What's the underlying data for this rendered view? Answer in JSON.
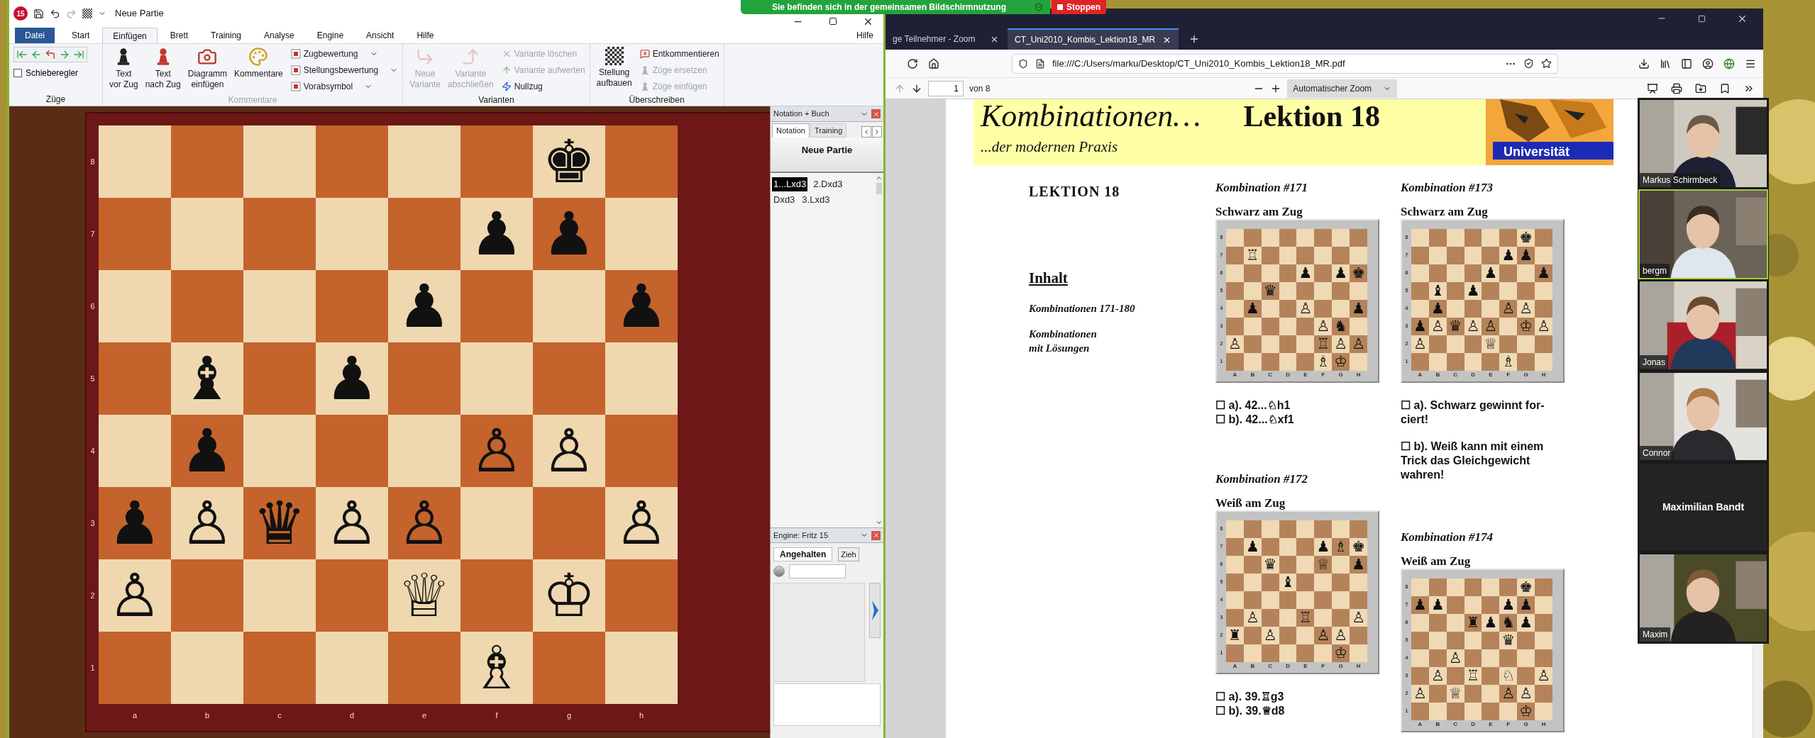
{
  "share_banner": {
    "text": "Sie befinden sich in der gemeinsamen Bildschirmnutzung",
    "stop_button": "Stoppen"
  },
  "chessbase": {
    "app_badge": "15",
    "title": "Neue Partie",
    "menu_tabs": [
      {
        "label": "Datei",
        "kind": "file"
      },
      {
        "label": "Start",
        "kind": "tab",
        "selected": false
      },
      {
        "label": "Einfügen",
        "kind": "tab",
        "selected": true
      },
      {
        "label": "Brett",
        "kind": "tab",
        "selected": false
      },
      {
        "label": "Training",
        "kind": "tab",
        "selected": false
      },
      {
        "label": "Analyse",
        "kind": "tab",
        "selected": false
      },
      {
        "label": "Engine",
        "kind": "tab",
        "selected": false
      },
      {
        "label": "Ansicht",
        "kind": "tab",
        "selected": false
      },
      {
        "label": "Hilfe",
        "kind": "tab",
        "selected": false
      }
    ],
    "help_link": "Hilfe",
    "ribbon": {
      "groups": [
        {
          "kind": "moves",
          "label": "Züge",
          "disabled": false,
          "checkbox": {
            "label": "Schieberegler",
            "checked": false
          }
        },
        {
          "kind": "comments",
          "label": "Kommentare",
          "disabled": true,
          "big_buttons": [
            {
              "lines": [
                "Text",
                "vor Zug"
              ],
              "disabled": false
            },
            {
              "lines": [
                "Text",
                "nach Zug"
              ],
              "disabled": false
            },
            {
              "lines": [
                "Diagramm",
                "einfügen"
              ],
              "disabled": false
            },
            {
              "lines": [
                "Kommentare"
              ],
              "disabled": false
            }
          ],
          "small_buttons": [
            {
              "label": "Zugbewertung",
              "disabled": false
            },
            {
              "label": "Stellungsbewertung",
              "disabled": false
            },
            {
              "label": "Vorabsymbol",
              "disabled": false
            }
          ]
        },
        {
          "kind": "variations",
          "label": "Varianten",
          "disabled": false,
          "big_buttons": [
            {
              "lines": [
                "Neue",
                "Variante"
              ],
              "disabled": true
            },
            {
              "lines": [
                "Variante",
                "abschließen"
              ],
              "disabled": true
            }
          ],
          "small_buttons": [
            {
              "label": "Variante löschen",
              "disabled": true
            },
            {
              "label": "Variante aufwerten",
              "disabled": true
            },
            {
              "label": "Nullzug",
              "disabled": false
            }
          ]
        },
        {
          "kind": "overwrite",
          "label": "Überschreiben",
          "disabled": false,
          "big_buttons": [
            {
              "lines": [
                "Stellung",
                "aufbauen"
              ],
              "disabled": false
            }
          ],
          "small_buttons": [
            {
              "label": "Entkommentieren",
              "disabled": false
            },
            {
              "label": "Züge ersetzen",
              "disabled": true
            },
            {
              "label": "Züge einfügen",
              "disabled": true
            }
          ]
        }
      ]
    },
    "board": {
      "files": [
        "a",
        "b",
        "c",
        "d",
        "e",
        "f",
        "g",
        "h"
      ],
      "ranks": [
        "8",
        "7",
        "6",
        "5",
        "4",
        "3",
        "2",
        "1"
      ],
      "rows": [
        [
          {},
          {},
          {},
          {},
          {},
          {},
          {
            "glyph": "♚"
          },
          {}
        ],
        [
          {},
          {},
          {},
          {},
          {},
          {
            "glyph": "♟"
          },
          {
            "glyph": "♟"
          },
          {}
        ],
        [
          {},
          {},
          {},
          {},
          {
            "glyph": "♟"
          },
          {},
          {},
          {
            "glyph": "♟"
          }
        ],
        [
          {},
          {
            "glyph": "♝"
          },
          {},
          {
            "glyph": "♟"
          },
          {},
          {},
          {},
          {}
        ],
        [
          {},
          {
            "glyph": "♟"
          },
          {},
          {},
          {},
          {
            "glyph": "♙"
          },
          {
            "glyph": "♙"
          },
          {}
        ],
        [
          {
            "glyph": "♟"
          },
          {
            "glyph": "♙"
          },
          {
            "glyph": "♛"
          },
          {
            "glyph": "♙"
          },
          {
            "glyph": "♙"
          },
          {},
          {},
          {
            "glyph": "♙"
          }
        ],
        [
          {
            "glyph": "♙"
          },
          {},
          {},
          {},
          {
            "glyph": "♕"
          },
          {},
          {
            "glyph": "♔"
          },
          {}
        ],
        [
          {},
          {},
          {},
          {},
          {},
          {
            "glyph": "♗"
          },
          {},
          {}
        ]
      ]
    },
    "notation_panel": {
      "title": "Notation + Buch",
      "tabs": [
        {
          "label": "Notation",
          "selected": true
        },
        {
          "label": "Training",
          "selected": false
        }
      ],
      "game_title": "Neue Partie",
      "move_lines": [
        [
          {
            "text": "1...Lxd3",
            "selected": true
          },
          {
            "text": "2.Dxd3",
            "selected": false
          }
        ],
        [
          {
            "text": "Dxd3",
            "selected": false
          },
          {
            "text": "3.Lxd3",
            "selected": false
          }
        ]
      ]
    },
    "engine_panel": {
      "title": "Engine: Fritz 15",
      "status_button": "Angehalten",
      "move_button": "Zieh"
    }
  },
  "browser": {
    "tabs": [
      {
        "title": "ge Teilnehmer - Zoom",
        "selected": false
      },
      {
        "title": "CT_Uni2010_Kombis_Lektion18_MR",
        "selected": true
      }
    ],
    "url": "file:///C:/Users/marku/Desktop/CT_Uni2010_Kombis_Lektion18_MR.pdf",
    "pdf_toolbar": {
      "page": "1",
      "page_count": "von 8",
      "zoom": "Automatischer Zoom"
    }
  },
  "pdf": {
    "header_title": "Kombinationen…",
    "header_lesson": "Lektion 18",
    "header_subtitle": "...der modernen Praxis",
    "logo_text": "Universität",
    "lesson_heading": "LEKTION 18",
    "contents_heading": "Inhalt",
    "contents_items": [
      {
        "lines": [
          "Kombinationen 171-180"
        ]
      },
      {
        "lines": [
          "Kombinationen",
          "mit Lösungen"
        ]
      }
    ],
    "columns": [
      [
        {
          "title": "Kombination #171",
          "to_move": "Schwarz am Zug",
          "files": [
            "A",
            "B",
            "C",
            "D",
            "E",
            "F",
            "G",
            "H"
          ],
          "ranks": [
            "8",
            "7",
            "6",
            "5",
            "4",
            "3",
            "2",
            "1"
          ],
          "rows": [
            [
              {},
              {},
              {},
              {},
              {},
              {},
              {},
              {}
            ],
            [
              {},
              {
                "glyph": "♖"
              },
              {},
              {},
              {},
              {},
              {},
              {}
            ],
            [
              {},
              {},
              {},
              {},
              {
                "glyph": "♟"
              },
              {},
              {
                "glyph": "♟"
              },
              {
                "glyph": "♚"
              }
            ],
            [
              {},
              {},
              {
                "glyph": "♛"
              },
              {},
              {},
              {},
              {},
              {}
            ],
            [
              {},
              {
                "glyph": "♟"
              },
              {},
              {},
              {
                "glyph": "♙"
              },
              {},
              {},
              {
                "glyph": "♟"
              }
            ],
            [
              {},
              {},
              {},
              {},
              {},
              {
                "glyph": "♙"
              },
              {
                "glyph": "♞"
              },
              {}
            ],
            [
              {
                "glyph": "♙"
              },
              {},
              {},
              {},
              {},
              {
                "glyph": "♖"
              },
              {
                "glyph": "♙"
              },
              {
                "glyph": "♙"
              }
            ],
            [
              {},
              {},
              {},
              {},
              {},
              {
                "glyph": "♗"
              },
              {
                "glyph": "♔"
              },
              {}
            ]
          ],
          "options": [
            {
              "lines": [
                "☐ a). 42...♘h1"
              ]
            },
            {
              "lines": [
                "☐ b). 42...♘xf1"
              ]
            }
          ]
        },
        {
          "title": "Kombination #172",
          "to_move": "Weiß am Zug",
          "files": [
            "A",
            "B",
            "C",
            "D",
            "E",
            "F",
            "G",
            "H"
          ],
          "ranks": [
            "8",
            "7",
            "6",
            "5",
            "4",
            "3",
            "2",
            "1"
          ],
          "rows": [
            [
              {},
              {},
              {},
              {},
              {},
              {},
              {},
              {}
            ],
            [
              {},
              {
                "glyph": "♟"
              },
              {},
              {},
              {},
              {
                "glyph": "♟"
              },
              {
                "glyph": "♗"
              },
              {
                "glyph": "♚"
              }
            ],
            [
              {},
              {},
              {
                "glyph": "♛"
              },
              {},
              {},
              {
                "glyph": "♕"
              },
              {},
              {
                "glyph": "♟"
              }
            ],
            [
              {},
              {},
              {},
              {
                "glyph": "♝"
              },
              {},
              {},
              {},
              {}
            ],
            [
              {},
              {},
              {},
              {},
              {},
              {},
              {},
              {}
            ],
            [
              {},
              {
                "glyph": "♙"
              },
              {},
              {},
              {
                "glyph": "♖"
              },
              {},
              {},
              {
                "glyph": "♙"
              }
            ],
            [
              {
                "glyph": "♜"
              },
              {},
              {
                "glyph": "♙"
              },
              {},
              {},
              {
                "glyph": "♙"
              },
              {
                "glyph": "♙"
              },
              {}
            ],
            [
              {},
              {},
              {},
              {},
              {},
              {},
              {
                "glyph": "♔"
              },
              {}
            ]
          ],
          "options": [
            {
              "lines": [
                "☐ a). 39.♖g3"
              ]
            },
            {
              "lines": [
                "☐ b). 39.♕d8"
              ]
            }
          ]
        }
      ],
      [
        {
          "title": "Kombination #173",
          "to_move": "Schwarz am Zug",
          "files": [
            "A",
            "B",
            "C",
            "D",
            "E",
            "F",
            "G",
            "H"
          ],
          "ranks": [
            "8",
            "7",
            "6",
            "5",
            "4",
            "3",
            "2",
            "1"
          ],
          "rows": [
            [
              {},
              {},
              {},
              {},
              {},
              {},
              {
                "glyph": "♚"
              },
              {}
            ],
            [
              {},
              {},
              {},
              {},
              {},
              {
                "glyph": "♟"
              },
              {
                "glyph": "♟"
              },
              {}
            ],
            [
              {},
              {},
              {},
              {},
              {
                "glyph": "♟"
              },
              {},
              {},
              {
                "glyph": "♟"
              }
            ],
            [
              {},
              {
                "glyph": "♝"
              },
              {},
              {
                "glyph": "♟"
              },
              {},
              {},
              {},
              {}
            ],
            [
              {},
              {
                "glyph": "♟"
              },
              {},
              {},
              {},
              {
                "glyph": "♙"
              },
              {
                "glyph": "♙"
              },
              {}
            ],
            [
              {
                "glyph": "♟"
              },
              {
                "glyph": "♙"
              },
              {
                "glyph": "♛"
              },
              {
                "glyph": "♙"
              },
              {
                "glyph": "♙"
              },
              {},
              {
                "glyph": "♔"
              },
              {
                "glyph": "♙"
              }
            ],
            [
              {
                "glyph": "♙"
              },
              {},
              {},
              {},
              {
                "glyph": "♕"
              },
              {},
              {},
              {}
            ],
            [
              {},
              {},
              {},
              {},
              {},
              {
                "glyph": "♗"
              },
              {},
              {}
            ]
          ],
          "options": [
            {
              "lines": [
                "☐ a). Schwarz gewinnt for-",
                "ciert!"
              ]
            },
            {
              "lines": [
                "☐ b). Weiß kann mit einem",
                "Trick das Gleichgewicht",
                "wahren!"
              ]
            }
          ]
        },
        {
          "title": "Kombination #174",
          "to_move": "Weiß am Zug",
          "files": [
            "A",
            "B",
            "C",
            "D",
            "E",
            "F",
            "G",
            "H"
          ],
          "ranks": [
            "8",
            "7",
            "6",
            "5",
            "4",
            "3",
            "2",
            "1"
          ],
          "rows": [
            [
              {},
              {},
              {},
              {},
              {},
              {},
              {
                "glyph": "♚"
              },
              {}
            ],
            [
              {
                "glyph": "♟"
              },
              {
                "glyph": "♟"
              },
              {},
              {},
              {},
              {
                "glyph": "♟"
              },
              {
                "glyph": "♟"
              },
              {}
            ],
            [
              {},
              {},
              {},
              {
                "glyph": "♜"
              },
              {
                "glyph": "♟"
              },
              {
                "glyph": "♞"
              },
              {
                "glyph": "♟"
              },
              {}
            ],
            [
              {},
              {},
              {},
              {},
              {},
              {
                "glyph": "♛"
              },
              {},
              {}
            ],
            [
              {},
              {},
              {
                "glyph": "♙"
              },
              {},
              {},
              {},
              {},
              {}
            ],
            [
              {},
              {
                "glyph": "♙"
              },
              {},
              {
                "glyph": "♖"
              },
              {},
              {
                "glyph": "♘"
              },
              {},
              {
                "glyph": "♙"
              }
            ],
            [
              {
                "glyph": "♙"
              },
              {},
              {
                "glyph": "♕"
              },
              {},
              {},
              {
                "glyph": "♙"
              },
              {
                "glyph": "♙"
              },
              {}
            ],
            [
              {},
              {},
              {},
              {},
              {},
              {},
              {
                "glyph": "♔"
              },
              {}
            ]
          ]
        }
      ]
    ]
  },
  "zoom_panel": {
    "tiles": [
      {
        "name": "Markus Schirmbeck",
        "kind": "video",
        "speaking": false
      },
      {
        "name": "bergm",
        "kind": "video",
        "speaking": true
      },
      {
        "name": "Jonas",
        "kind": "video",
        "speaking": false
      },
      {
        "name": "Connor",
        "kind": "video",
        "speaking": false
      },
      {
        "name": "Maximilian Bandt",
        "kind": "name_only",
        "speaking": false
      },
      {
        "name": "Maxim",
        "kind": "video",
        "speaking": false
      }
    ]
  }
}
